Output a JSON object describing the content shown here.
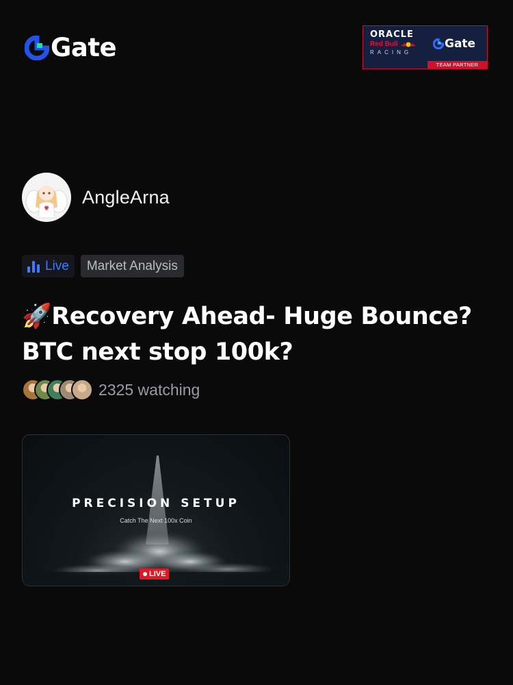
{
  "header": {
    "logo_text": "Gate",
    "partner": {
      "oracle": "ORACLE",
      "redbull": "Red Bull",
      "racing": "RACING",
      "gate_text": "Gate",
      "strip": "TEAM PARTNER"
    }
  },
  "author": {
    "name": "AngleArna",
    "avatar_icon": "angel-avatar-icon"
  },
  "tags": {
    "live_label": "Live",
    "category": "Market Analysis"
  },
  "post": {
    "title_emoji": "🚀",
    "title": "Recovery Ahead- Huge Bounce? BTC next stop 100k?"
  },
  "watching": {
    "text": "2325 watching",
    "avatar_colors": [
      "#a8743b",
      "#6d8a4a",
      "#3f7f5a",
      "#9c8a74",
      "#c7a98a"
    ]
  },
  "video": {
    "title": "PRECISION SETUP",
    "subtitle": "Catch The Next 100x Coin",
    "badge": "LIVE"
  },
  "colors": {
    "background": "#0a0a0b",
    "accent_blue": "#3d7cff",
    "gate_green": "#17e6a1",
    "live_red": "#e01925"
  }
}
